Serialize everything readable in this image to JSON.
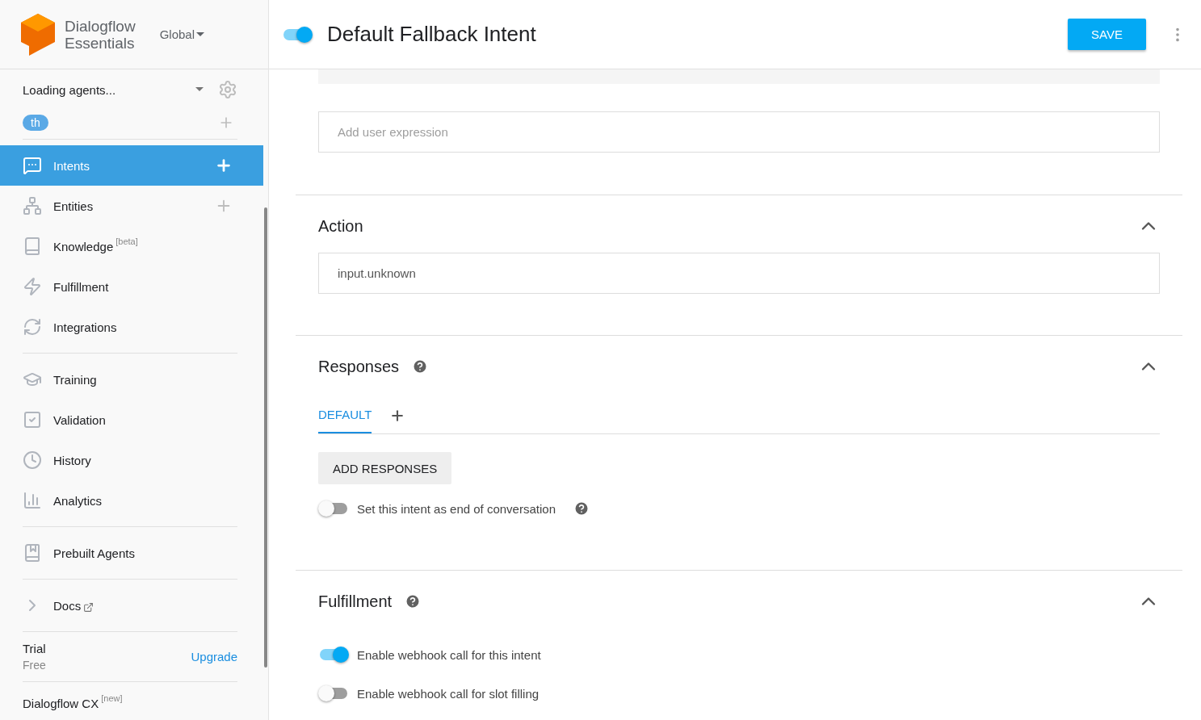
{
  "sidebar": {
    "brand": {
      "line1": "Dialogflow",
      "line2": "Essentials"
    },
    "region": "Global",
    "agent": "Loading agents...",
    "language_tag": "th",
    "nav_groups": [
      [
        {
          "kind": "intents",
          "label": "Intents",
          "selected": true,
          "addable": true
        },
        {
          "kind": "entities",
          "label": "Entities",
          "selected": false,
          "addable": true
        },
        {
          "kind": "knowledge",
          "label": "Knowledge",
          "badge": "[beta]",
          "selected": false
        },
        {
          "kind": "fulfillment",
          "label": "Fulfillment",
          "selected": false
        },
        {
          "kind": "integrations",
          "label": "Integrations",
          "selected": false
        }
      ],
      [
        {
          "kind": "training",
          "label": "Training",
          "selected": false
        },
        {
          "kind": "validation",
          "label": "Validation",
          "selected": false
        },
        {
          "kind": "history",
          "label": "History",
          "selected": false
        },
        {
          "kind": "analytics",
          "label": "Analytics",
          "selected": false
        }
      ],
      [
        {
          "kind": "prebuilt",
          "label": "Prebuilt Agents",
          "selected": false
        }
      ],
      [
        {
          "kind": "docs",
          "label": "Docs",
          "selected": false,
          "external": true
        }
      ]
    ],
    "plan": {
      "name": "Trial",
      "tier": "Free",
      "action": "Upgrade"
    },
    "footer_link": {
      "label": "Dialogflow CX",
      "badge": "[new]"
    }
  },
  "header": {
    "intent_enabled": true,
    "title": "Default Fallback Intent",
    "save": "SAVE"
  },
  "training_phrases": {
    "placeholder": "Add user expression"
  },
  "sections": [
    {
      "kind": "action",
      "title": "Action",
      "expanded": true,
      "value": "input.unknown"
    },
    {
      "kind": "responses",
      "title": "Responses",
      "help": true,
      "expanded": true,
      "tabs": [
        {
          "label": "DEFAULT",
          "selected": true
        }
      ],
      "add_button": "ADD RESPONSES",
      "toggles": [
        {
          "label": "Set this intent as end of conversation",
          "on": false,
          "help": true
        }
      ]
    },
    {
      "kind": "fulfillment",
      "title": "Fulfillment",
      "help": true,
      "expanded": true,
      "toggles": [
        {
          "label": "Enable webhook call for this intent",
          "on": true
        },
        {
          "label": "Enable webhook call for slot filling",
          "on": false
        }
      ]
    }
  ]
}
